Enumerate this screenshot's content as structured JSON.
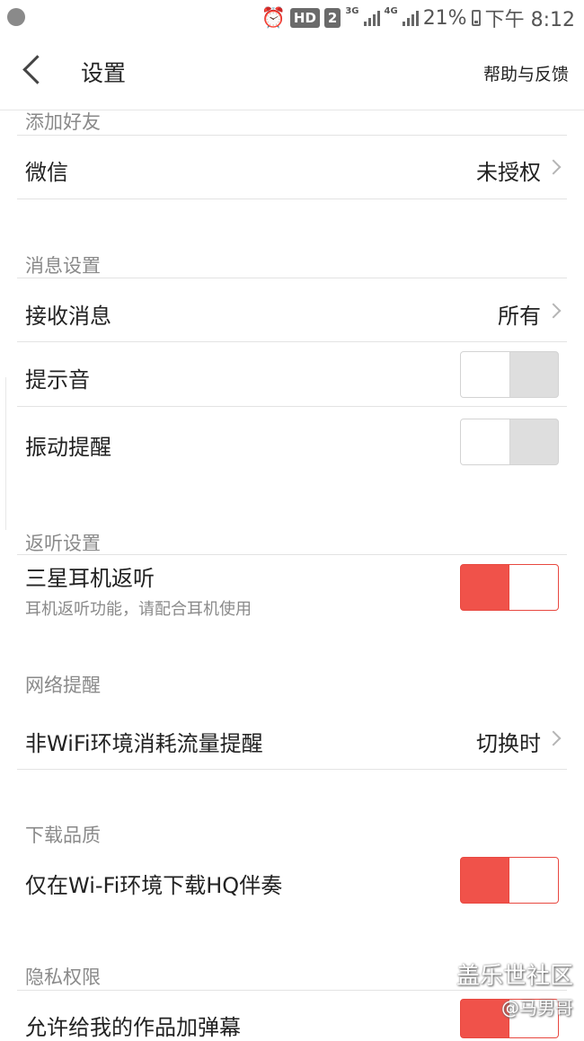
{
  "status_bar": {
    "hd": "HD",
    "sim": "2",
    "net1": "3G",
    "net2": "4G",
    "battery": "21%",
    "time": "下午 8:12"
  },
  "header": {
    "title": "设置",
    "help": "帮助与反馈"
  },
  "sections": {
    "add_friends": {
      "title": "添加好友",
      "wechat": {
        "label": "微信",
        "value": "未授权"
      }
    },
    "message": {
      "title": "消息设置",
      "receive": {
        "label": "接收消息",
        "value": "所有"
      },
      "sound": {
        "label": "提示音",
        "enabled": false
      },
      "vibrate": {
        "label": "振动提醒",
        "enabled": false
      }
    },
    "monitor": {
      "title": "返听设置",
      "samsung": {
        "label": "三星耳机返听",
        "sub": "耳机返听功能，请配合耳机使用",
        "enabled": true
      }
    },
    "network": {
      "title": "网络提醒",
      "non_wifi": {
        "label": "非WiFi环境消耗流量提醒",
        "value": "切换时"
      }
    },
    "download": {
      "title": "下载品质",
      "hq": {
        "label": "仅在Wi-Fi环境下载HQ伴奏",
        "enabled": true
      }
    },
    "privacy": {
      "title": "隐私权限",
      "danmaku": {
        "label": "允许给我的作品加弹幕",
        "enabled": true
      }
    }
  },
  "watermark": {
    "site": "盖乐世社区",
    "user": "@马男哥"
  },
  "colors": {
    "accent": "#f0524a",
    "toggle_off": "#dedede",
    "section_title": "#8a8a8a"
  }
}
